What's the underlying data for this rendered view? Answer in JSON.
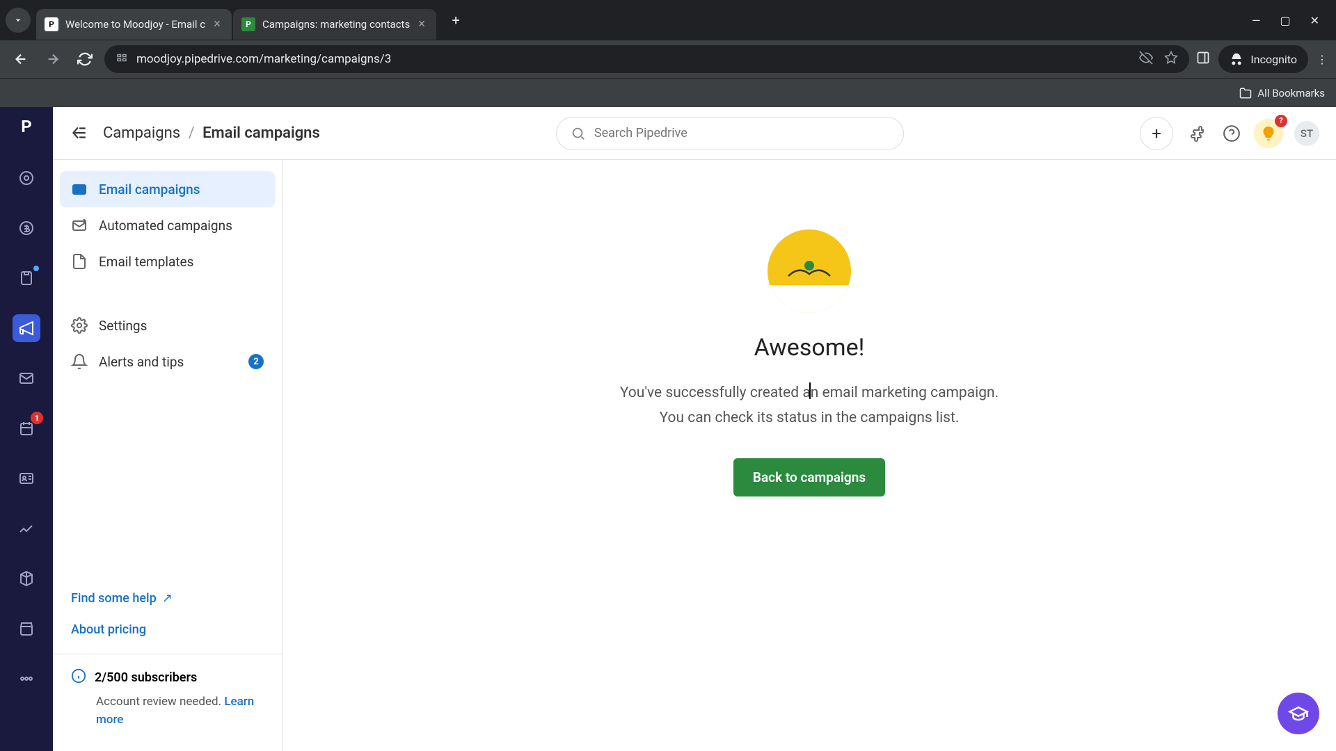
{
  "browser": {
    "tabs": [
      {
        "title": "Welcome to Moodjoy - Email c",
        "favicon": "P"
      },
      {
        "title": "Campaigns: marketing contacts",
        "favicon": "P"
      }
    ],
    "url": "moodjoy.pipedrive.com/marketing/campaigns/3",
    "incognito_label": "Incognito",
    "all_bookmarks": "All Bookmarks"
  },
  "header": {
    "breadcrumb_root": "Campaigns",
    "breadcrumb_current": "Email campaigns",
    "search_placeholder": "Search Pipedrive",
    "avatar_initials": "ST",
    "notif_count": "?"
  },
  "sidebar": {
    "items": [
      {
        "label": "Email campaigns"
      },
      {
        "label": "Automated campaigns"
      },
      {
        "label": "Email templates"
      },
      {
        "label": "Settings"
      },
      {
        "label": "Alerts and tips",
        "badge": "2"
      }
    ],
    "help_link": "Find some help",
    "pricing_link": "About pricing",
    "subscriber_count": "2/500 subscribers",
    "subscriber_text": "Account review needed.",
    "learn_more": "Learn more"
  },
  "content": {
    "headline": "Awesome!",
    "line1": "You've successfully created an email marketing campaign.",
    "line2": "You can check its status in the campaigns list.",
    "cta": "Back to campaigns"
  },
  "nav_rail": {
    "badge_1": "1"
  }
}
